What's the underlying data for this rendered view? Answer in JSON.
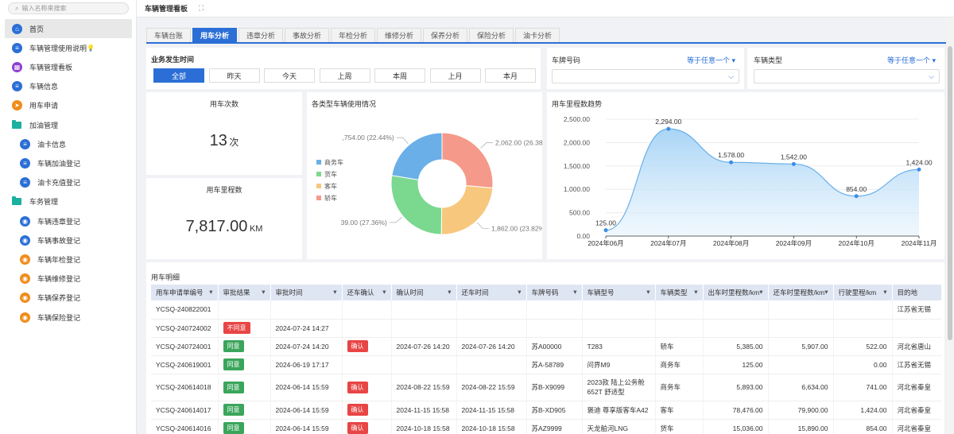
{
  "search": {
    "placeholder": "输入名称来搜索"
  },
  "nav": [
    {
      "label": "首页",
      "icon": "home-icon",
      "color": "blue",
      "indent": false
    },
    {
      "label": "车辆管理使用说明",
      "icon": "document-icon",
      "color": "blue",
      "indent": false,
      "bulb": "💡"
    },
    {
      "label": "车辆管理看板",
      "icon": "dashboard-icon",
      "color": "purple",
      "indent": false
    },
    {
      "label": "车辆信息",
      "icon": "document-icon",
      "color": "blue",
      "indent": false
    },
    {
      "label": "用车申请",
      "icon": "send-icon",
      "color": "orange",
      "indent": false
    },
    {
      "label": "加油管理",
      "icon": "folder-icon",
      "color": "folder",
      "indent": false
    },
    {
      "label": "油卡信息",
      "icon": "document-icon",
      "color": "blue",
      "indent": true
    },
    {
      "label": "车辆加油登记",
      "icon": "document-icon",
      "color": "blue",
      "indent": true
    },
    {
      "label": "油卡充值登记",
      "icon": "document-icon",
      "color": "blue",
      "indent": true
    },
    {
      "label": "车务管理",
      "icon": "folder-icon",
      "color": "folder",
      "indent": false
    },
    {
      "label": "车辆违章登记",
      "icon": "record-icon",
      "color": "blue",
      "indent": true
    },
    {
      "label": "车辆事故登记",
      "icon": "record-icon",
      "color": "blue",
      "indent": true
    },
    {
      "label": "车辆年检登记",
      "icon": "record-icon",
      "color": "orange",
      "indent": true
    },
    {
      "label": "车辆维修登记",
      "icon": "record-icon",
      "color": "orange",
      "indent": true
    },
    {
      "label": "车辆保养登记",
      "icon": "record-icon",
      "color": "orange",
      "indent": true
    },
    {
      "label": "车辆保险登记",
      "icon": "record-icon",
      "color": "orange",
      "indent": true
    }
  ],
  "topbar": {
    "title": "车辆管理看板"
  },
  "tabs": [
    "车辆台账",
    "用车分析",
    "违章分析",
    "事故分析",
    "年检分析",
    "维修分析",
    "保养分析",
    "保险分析",
    "油卡分析"
  ],
  "active_tab": 1,
  "filter": {
    "title": "业务发生时间",
    "buttons": [
      "全部",
      "昨天",
      "今天",
      "上周",
      "本周",
      "上月",
      "本月"
    ],
    "active": 0,
    "plate_label": "车牌号码",
    "plate_op": "等于任意一个 ▾",
    "type_label": "车辆类型",
    "type_op": "等于任意一个 ▾"
  },
  "kpi": {
    "count_title": "用车次数",
    "count_value": "13",
    "count_unit": "次",
    "mileage_title": "用车里程数",
    "mileage_value": "7,817.00",
    "mileage_unit": "KM"
  },
  "colors": {
    "accent": "#2b6fd6",
    "business": "#6aafe8",
    "truck": "#7bd88f",
    "bus": "#f7c77e",
    "car": "#f59a8a"
  },
  "chart_data": [
    {
      "type": "pie",
      "title": "各类型车辆使用情况",
      "labels": [
        "商务车",
        "货车",
        "客车",
        "轿车"
      ],
      "values": [
        1754.0,
        2139.0,
        1862.0,
        2062.0
      ],
      "percent_labels": [
        ",754.00 (22.44%)",
        "39.00 (27.36%)",
        "1,862.00 (23.82%",
        "2,062.00 (26.38"
      ],
      "legend": "left"
    },
    {
      "type": "area",
      "title": "用车里程数趋势",
      "x": [
        "2024年06月",
        "2024年07月",
        "2024年08月",
        "2024年09月",
        "2024年10月",
        "2024年11月"
      ],
      "values": [
        125.0,
        2294.0,
        1578.0,
        1542.0,
        854.0,
        1424.0
      ],
      "value_labels": [
        "125.00",
        "2,294.00",
        "1,578.00",
        "1,542.00",
        "854.00",
        "1,424.00"
      ],
      "yticks": [
        "2,500.00",
        "2,000.00",
        "1,500.00",
        "1,000.00",
        "500.00",
        "0.00"
      ],
      "ylim": [
        0,
        2500
      ],
      "grid": true
    }
  ],
  "table": {
    "title": "用车明细",
    "headers": [
      "用车申请单编号",
      "审批结果",
      "审批时间",
      "还车确认",
      "确认时间",
      "还车时间",
      "车牌号码",
      "车辆型号",
      "车辆类型",
      "出车时里程数/km",
      "还车时里程数/km",
      "行驶里程/km",
      "目的地"
    ],
    "rows": [
      [
        "YCSQ-240822001",
        "",
        "",
        "",
        "",
        "",
        "",
        "",
        "",
        "",
        "",
        "",
        "江苏省无锡"
      ],
      [
        "YCSQ-240724002",
        "不同意",
        "2024-07-24 14:27",
        "",
        "",
        "",
        "",
        "",
        "",
        "",
        "",
        "",
        ""
      ],
      [
        "YCSQ-240724001",
        "同意",
        "2024-07-24 14:20",
        "确认",
        "2024-07-26 14:20",
        "2024-07-26 14:20",
        "苏A00000",
        "T283",
        "轿车",
        "5,385.00",
        "5,907.00",
        "522.00",
        "河北省唐山"
      ],
      [
        "YCSQ-240619001",
        "同意",
        "2024-06-19 17:17",
        "",
        "",
        "",
        "苏A-58789",
        "问界M9",
        "商务车",
        "125.00",
        "",
        "0.00",
        "江苏省无锡"
      ],
      [
        "YCSQ-240614018",
        "同意",
        "2024-06-14 15:59",
        "确认",
        "2024-08-22 15:59",
        "2024-08-22 15:59",
        "苏B-X9099",
        "2023款 陆上公务舱 652T 舒适型",
        "商务车",
        "5,893.00",
        "6,634.00",
        "741.00",
        "河北省秦皇"
      ],
      [
        "YCSQ-240614017",
        "同意",
        "2024-06-14 15:59",
        "确认",
        "2024-11-15 15:58",
        "2024-11-15 15:58",
        "苏B-XD905",
        "褒迪 尊享版客车A42",
        "客车",
        "78,476.00",
        "79,900.00",
        "1,424.00",
        "河北省秦皇"
      ],
      [
        "YCSQ-240614016",
        "同意",
        "2024-06-14 15:59",
        "确认",
        "2024-10-18 15:58",
        "2024-10-18 15:58",
        "苏AZ9999",
        "天龙舶河LNG",
        "货车",
        "15,036.00",
        "15,890.00",
        "854.00",
        "河北省秦皇"
      ]
    ]
  }
}
